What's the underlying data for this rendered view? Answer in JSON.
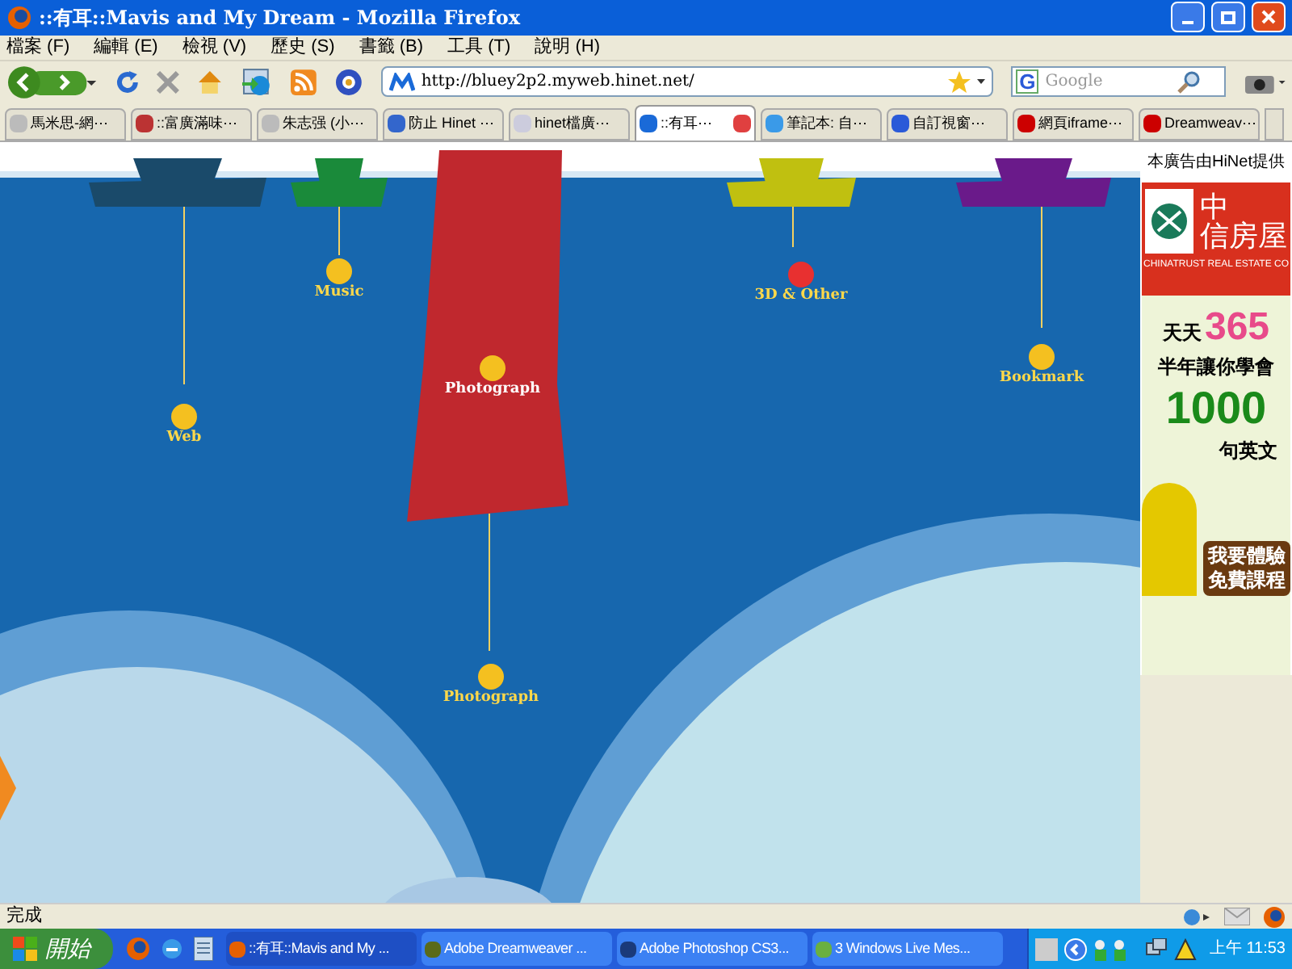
{
  "window": {
    "title": "::有耳::Mavis and My Dream - Mozilla Firefox"
  },
  "menu": [
    "檔案 (F)",
    "編輯 (E)",
    "檢視 (V)",
    "歷史 (S)",
    "書籤 (B)",
    "工具 (T)",
    "說明 (H)"
  ],
  "address": "http://bluey2p2.myweb.hinet.net/",
  "search": {
    "engine": "G",
    "placeholder": "Google"
  },
  "tabs": [
    {
      "label": "馬米思-網⋯",
      "selected": false
    },
    {
      "label": "::富廣滿味⋯",
      "selected": false
    },
    {
      "label": "朱志强 (小⋯",
      "selected": false
    },
    {
      "label": "防止 Hinet ⋯",
      "selected": false
    },
    {
      "label": "hinet檔廣⋯",
      "selected": false
    },
    {
      "label": "::有耳⋯",
      "selected": true
    },
    {
      "label": "筆記本: 自⋯",
      "selected": false
    },
    {
      "label": "自訂視窗⋯",
      "selected": false
    },
    {
      "label": "網頁iframe⋯",
      "selected": false
    },
    {
      "label": "Dreamweav⋯",
      "selected": false
    }
  ],
  "flash_labels": [
    "Web",
    "Music",
    "Photograph",
    "Photograph",
    "3D & Other",
    "Bookmark"
  ],
  "ad": {
    "caption": "本廣告由HiNet提供",
    "brand": "中",
    "brand2": "信房屋",
    "brand_en": "CHINATRUST REAL ESTATE CO",
    "line1": "天天",
    "number1": "365",
    "line2": "半年讓你學會",
    "number2": "1000",
    "line3": "句英文",
    "cta": "我要體驗免費課程"
  },
  "status": "完成",
  "taskbar": {
    "start": "開始",
    "tasks": [
      {
        "label": "::有耳::Mavis and My ...",
        "selected": true
      },
      {
        "label": "Adobe Dreamweaver ...",
        "selected": false
      },
      {
        "label": "Adobe Photoshop CS3...",
        "selected": false
      },
      {
        "label": "3  Windows Live Mes...",
        "selected": false
      }
    ],
    "clock": "上午 11:53"
  }
}
